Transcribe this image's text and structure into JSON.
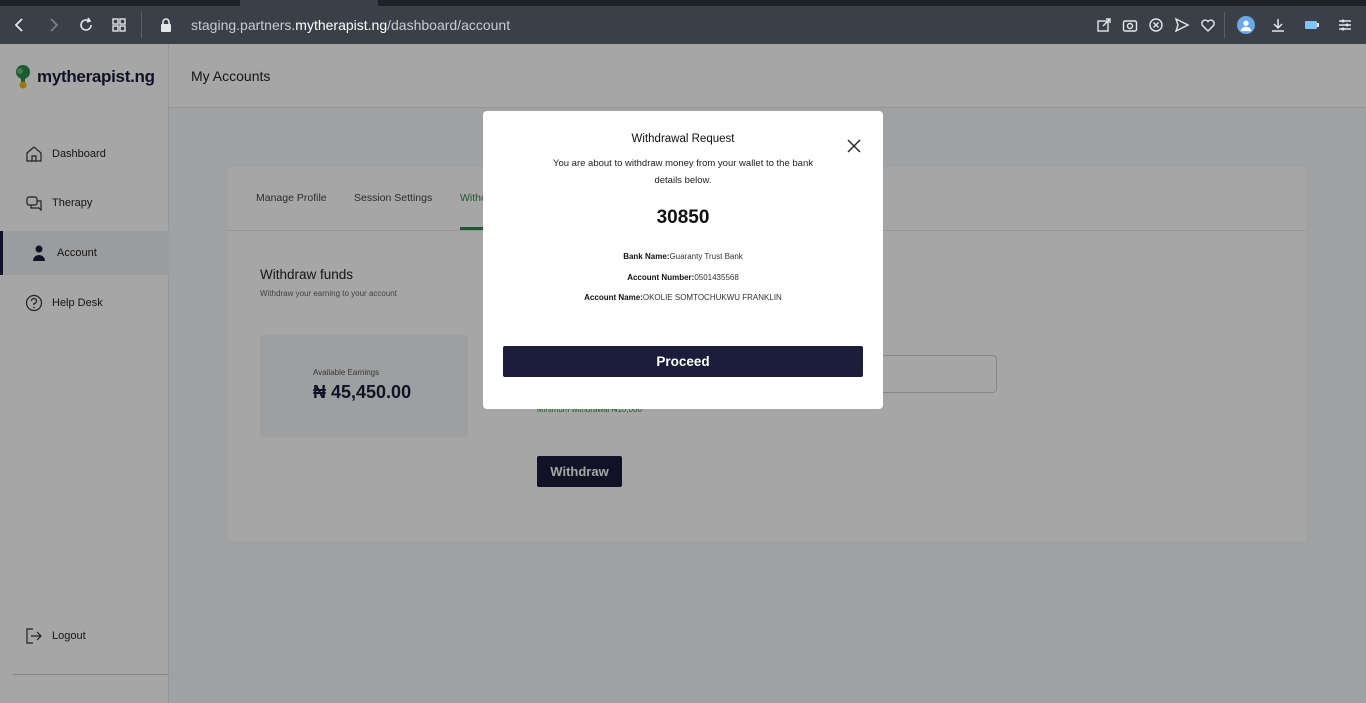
{
  "browser": {
    "url_prefix": "staging.partners.",
    "url_domain": "mytherapist.ng",
    "url_path": "/dashboard/account",
    "icons": [
      "back-icon",
      "forward-icon",
      "reload-icon",
      "tabs-grid-icon",
      "lock-icon",
      "share-icon",
      "camera-icon",
      "block-icon",
      "send-icon",
      "heart-icon",
      "profile-icon",
      "download-icon",
      "battery-icon",
      "menu-icon"
    ]
  },
  "brand": {
    "name": "mytherapist.ng",
    "accent": "#2c8c4a",
    "navy": "#1b1d3a"
  },
  "sidebar": {
    "items": [
      {
        "label": "Dashboard",
        "icon": "home-icon"
      },
      {
        "label": "Therapy",
        "icon": "chat-icon"
      },
      {
        "label": "Account",
        "icon": "person-icon"
      },
      {
        "label": "Help Desk",
        "icon": "help-icon"
      }
    ],
    "logout": "Logout"
  },
  "header": {
    "title": "My Accounts"
  },
  "tabs": [
    "Manage Profile",
    "Session Settings",
    "Witho"
  ],
  "withdraw": {
    "title": "Withdraw funds",
    "subtitle": "Withdraw your earning to your account",
    "earnings_label": "Available Earnings",
    "earnings_value": "₦ 45,450.00",
    "min_text": "Minimum withdrawal ₦10,000",
    "button": "Withdraw"
  },
  "modal": {
    "title": "Withdrawal Request",
    "description": "You are about to withdraw money from your wallet to the bank details below.",
    "amount": "30850",
    "bank_label": "Bank Name:",
    "bank_value": "Guaranty Trust Bank",
    "acct_num_label": "Account Number:",
    "acct_num_value": "0501435568",
    "acct_name_label": "Account Name:",
    "acct_name_value": "OKOLIE SOMTOCHUKWU FRANKLIN",
    "proceed": "Proceed"
  }
}
